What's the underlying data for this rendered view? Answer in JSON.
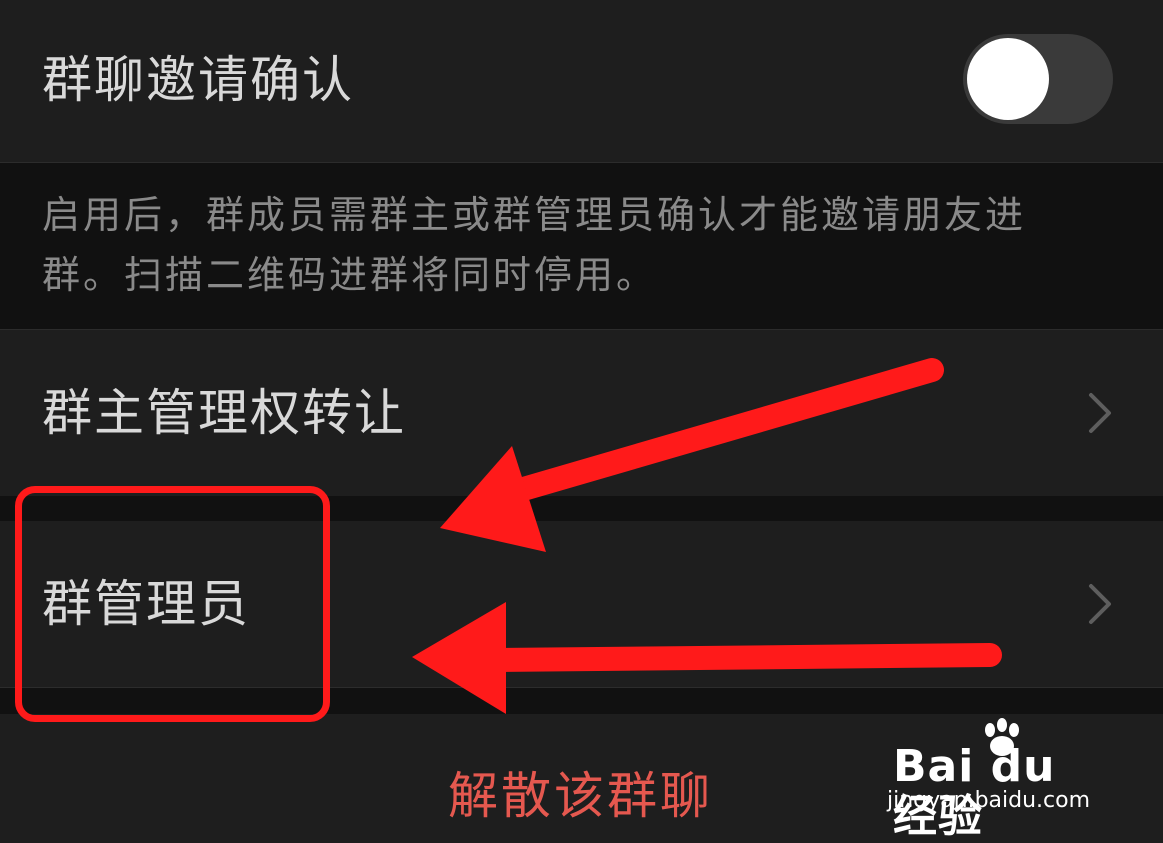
{
  "invite_confirm": {
    "label": "群聊邀请确认",
    "toggle_on": false,
    "description": "启用后，群成员需群主或群管理员确认才能邀请朋友进群。扫描二维码进群将同时停用。"
  },
  "menu": {
    "transfer_label": "群主管理权转让",
    "admins_label": "群管理员"
  },
  "dissolve_label": "解散该群聊",
  "colors": {
    "background": "#111111",
    "cell": "#1e1e1e",
    "danger": "#e5584f",
    "annotation": "#ff1a1a"
  },
  "watermark": {
    "logo": "Bai du 经验",
    "url": "jingyan.baidu.com"
  }
}
